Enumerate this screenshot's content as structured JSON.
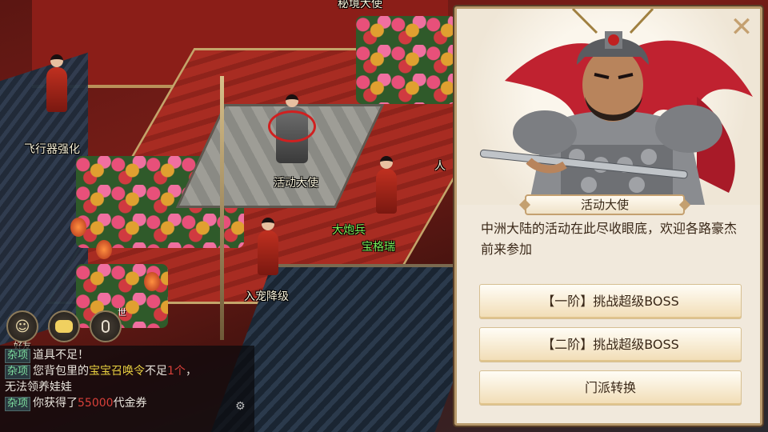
{
  "npcs": {
    "mijing": "秘境大使",
    "feixingqi": "飞行器强化",
    "huodong": "活动大使",
    "dapaobing": "大炮兵",
    "baobao": "宝格瑞",
    "ruchong": "入宠降级",
    "partial_right": "人"
  },
  "hud": {
    "friends_label": "好友",
    "voice_badge": "世"
  },
  "chat": {
    "lines": [
      {
        "channel": "杂项",
        "text": "道具不足！"
      },
      {
        "channel": "杂项",
        "pre": "您背包里的",
        "item": "宝宝召唤令",
        "mid": "不足",
        "count": "1个",
        "post": "，",
        "cont": "无法领养娃娃"
      },
      {
        "channel": "杂项",
        "pre": "你获得了",
        "amount": "55000",
        "post": "代金券"
      }
    ]
  },
  "dialog": {
    "npc_name": "活动大使",
    "description": "中洲大陆的活动在此尽收眼底，欢迎各路豪杰前来参加",
    "options": [
      "【一阶】挑战超级BOSS",
      "【二阶】挑战超级BOSS",
      "门派转换"
    ]
  },
  "colors": {
    "dialog_bg": "#f1e9dc",
    "button_gradient_bottom": "#f1dcb4",
    "npc_name_green": "#7cf05a",
    "chat_channel": "#7fe0a0",
    "highlight_yellow": "#e8d040",
    "highlight_red": "#d8403a"
  }
}
